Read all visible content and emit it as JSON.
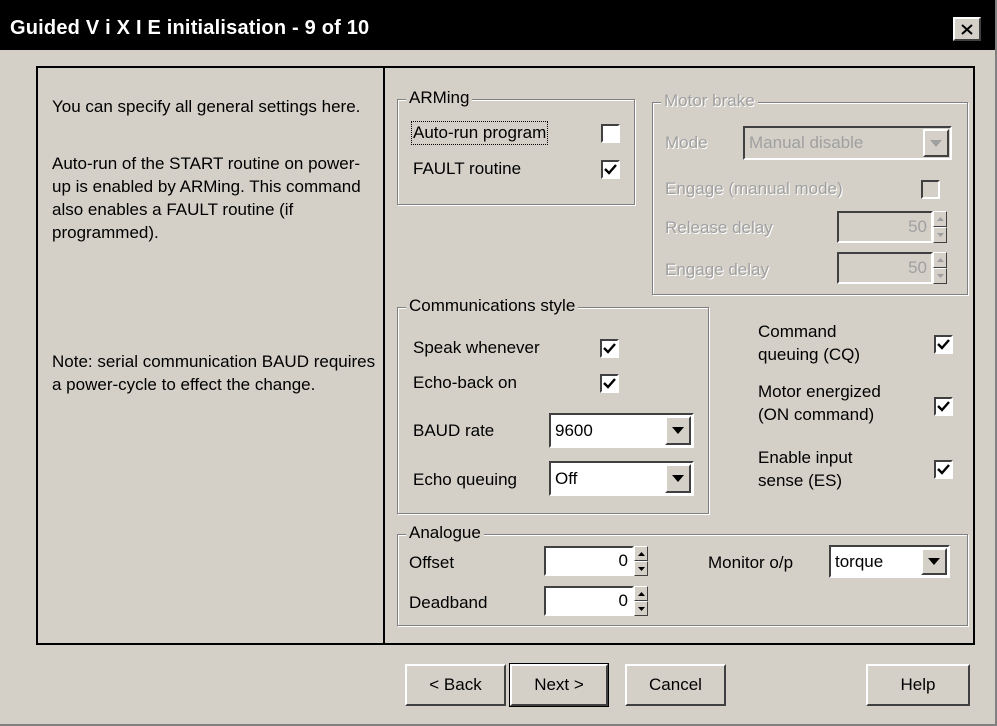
{
  "window": {
    "title": "Guided V i X I E initialisation - 9 of 10"
  },
  "info": {
    "para1": "You can specify all general settings here.",
    "para2": "Auto-run of the START routine on power-up is enabled by ARMing. This command also enables a FAULT routine (if programmed).",
    "para3": "Note: serial communication BAUD requires a power-cycle to effect the change."
  },
  "arming": {
    "title": "ARMing",
    "autorun_label": "Auto-run program",
    "autorun_checked": false,
    "fault_label": "FAULT routine",
    "fault_checked": true
  },
  "motor_brake": {
    "title": "Motor brake",
    "mode_label": "Mode",
    "mode_value": "Manual disable",
    "engage_manual_label": "Engage (manual mode)",
    "engage_manual_checked": false,
    "release_delay_label": "Release delay",
    "release_delay_value": "50",
    "engage_delay_label": "Engage delay",
    "engage_delay_value": "50"
  },
  "comms": {
    "title": "Communications style",
    "speak_label": "Speak whenever",
    "speak_checked": true,
    "echo_label": "Echo-back on",
    "echo_checked": true,
    "baud_label": "BAUD rate",
    "baud_value": "9600",
    "echo_queuing_label": "Echo queuing",
    "echo_queuing_value": "Off"
  },
  "options": {
    "cq_label_1": "Command",
    "cq_label_2": "queuing (CQ)",
    "cq_checked": true,
    "motor_label_1": "Motor energized",
    "motor_label_2": "(ON command)",
    "motor_checked": true,
    "es_label_1": "Enable input",
    "es_label_2": "sense (ES)",
    "es_checked": true
  },
  "analogue": {
    "title": "Analogue",
    "offset_label": "Offset",
    "offset_value": "0",
    "deadband_label": "Deadband",
    "deadband_value": "0",
    "monitor_label": "Monitor o/p",
    "monitor_value": "torque"
  },
  "buttons": {
    "back": "< Back",
    "next": "Next >",
    "cancel": "Cancel",
    "help": "Help"
  }
}
